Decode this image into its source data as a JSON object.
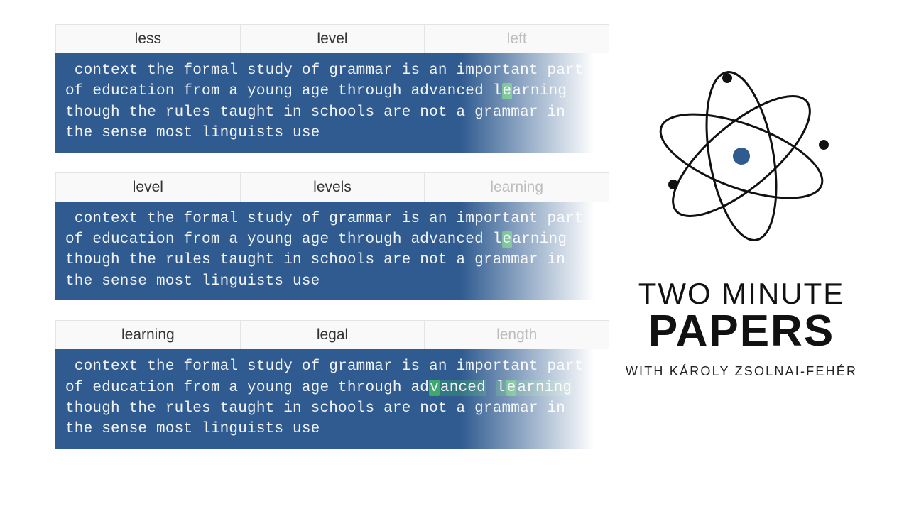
{
  "blocks": [
    {
      "suggestions": [
        {
          "label": "less",
          "faded": false
        },
        {
          "label": "level",
          "faded": false
        },
        {
          "label": "left",
          "faded": true
        }
      ],
      "body_html": " context the formal study of grammar is an important part of education from a young age through advanced l<span class=\"hl-strong\">e</span>arning though the rules taught in schools are not a grammar in the sense most linguists use"
    },
    {
      "suggestions": [
        {
          "label": "level",
          "faded": false
        },
        {
          "label": "levels",
          "faded": false
        },
        {
          "label": "learning",
          "faded": true
        }
      ],
      "body_html": " context the formal study of grammar is an important part of education from a young age through advanced l<span class=\"hl-strong\">e</span>arning though the rules taught in schools are not a grammar in the sense most linguists use"
    },
    {
      "suggestions": [
        {
          "label": "learning",
          "faded": false
        },
        {
          "label": "legal",
          "faded": false
        },
        {
          "label": "length",
          "faded": true
        }
      ],
      "body_html": " context the formal study of grammar is an important part of education from a young age through ad<span class=\"hl-strong\">v</span><span class=\"hl-weak\">anced</span> <span class=\"hl-weak\">l</span><span class=\"hl-strong\">e</span><span class=\"hl-weak\">arning</span> though the rules taught in schools are not a grammar in the sense most linguists use"
    }
  ],
  "brand": {
    "line1": "TWO MINUTE",
    "line2": "PAPERS",
    "subtitle": "WITH KÁROLY ZSOLNAI-FEHÉR"
  },
  "colors": {
    "panel_bg": "#2f5b90",
    "highlight_strong": "#3fa86a",
    "highlight_weak": "rgba(63,168,106,0.35)"
  }
}
